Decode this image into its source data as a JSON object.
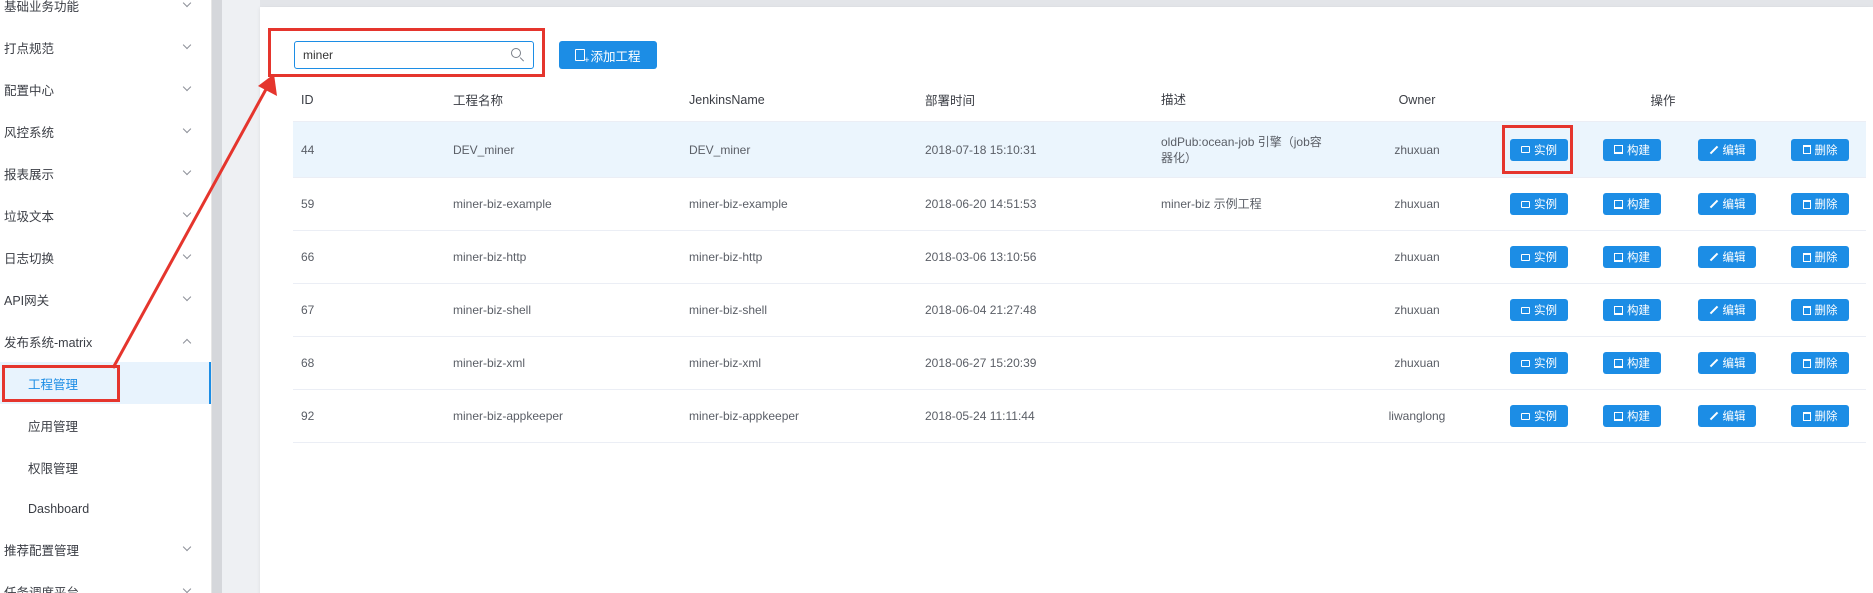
{
  "sidebar": {
    "items": [
      {
        "label": "基础业务功能",
        "expanded": false
      },
      {
        "label": "打点规范",
        "expanded": false
      },
      {
        "label": "配置中心",
        "expanded": false
      },
      {
        "label": "风控系统",
        "expanded": false
      },
      {
        "label": "报表展示",
        "expanded": false
      },
      {
        "label": "垃圾文本",
        "expanded": false
      },
      {
        "label": "日志切换",
        "expanded": false
      },
      {
        "label": "API网关",
        "expanded": false
      },
      {
        "label": "发布系统-matrix",
        "expanded": true
      },
      {
        "label": "工程管理",
        "sub": true,
        "active": true
      },
      {
        "label": "应用管理",
        "sub": true
      },
      {
        "label": "权限管理",
        "sub": true
      },
      {
        "label": "Dashboard",
        "sub": true
      },
      {
        "label": "推荐配置管理",
        "expanded": false
      },
      {
        "label": "任务调度平台",
        "expanded": false
      }
    ]
  },
  "toolbar": {
    "search_value": "miner",
    "add_label": "添加工程"
  },
  "table": {
    "headers": {
      "id": "ID",
      "name": "工程名称",
      "jenkins": "JenkinsName",
      "time": "部署时间",
      "desc": "描述",
      "owner": "Owner",
      "ops": "操作"
    },
    "actions": {
      "instance": "实例",
      "build": "构建",
      "edit": "编辑",
      "delete": "删除"
    },
    "rows": [
      {
        "id": "44",
        "name": "DEV_miner",
        "jenkins": "DEV_miner",
        "time": "2018-07-18 15:10:31",
        "desc": "oldPub:ocean-job 引擎（job容器化）",
        "owner": "zhuxuan"
      },
      {
        "id": "59",
        "name": "miner-biz-example",
        "jenkins": "miner-biz-example",
        "time": "2018-06-20 14:51:53",
        "desc": "miner-biz 示例工程",
        "owner": "zhuxuan"
      },
      {
        "id": "66",
        "name": "miner-biz-http",
        "jenkins": "miner-biz-http",
        "time": "2018-03-06 13:10:56",
        "desc": "",
        "owner": "zhuxuan"
      },
      {
        "id": "67",
        "name": "miner-biz-shell",
        "jenkins": "miner-biz-shell",
        "time": "2018-06-04 21:27:48",
        "desc": "",
        "owner": "zhuxuan"
      },
      {
        "id": "68",
        "name": "miner-biz-xml",
        "jenkins": "miner-biz-xml",
        "time": "2018-06-27 15:20:39",
        "desc": "",
        "owner": "zhuxuan"
      },
      {
        "id": "92",
        "name": "miner-biz-appkeeper",
        "jenkins": "miner-biz-appkeeper",
        "time": "2018-05-24 11:11:44",
        "desc": "",
        "owner": "liwanglong"
      }
    ]
  },
  "colors": {
    "accent": "#1c8de5",
    "annotation": "#e5352d"
  }
}
